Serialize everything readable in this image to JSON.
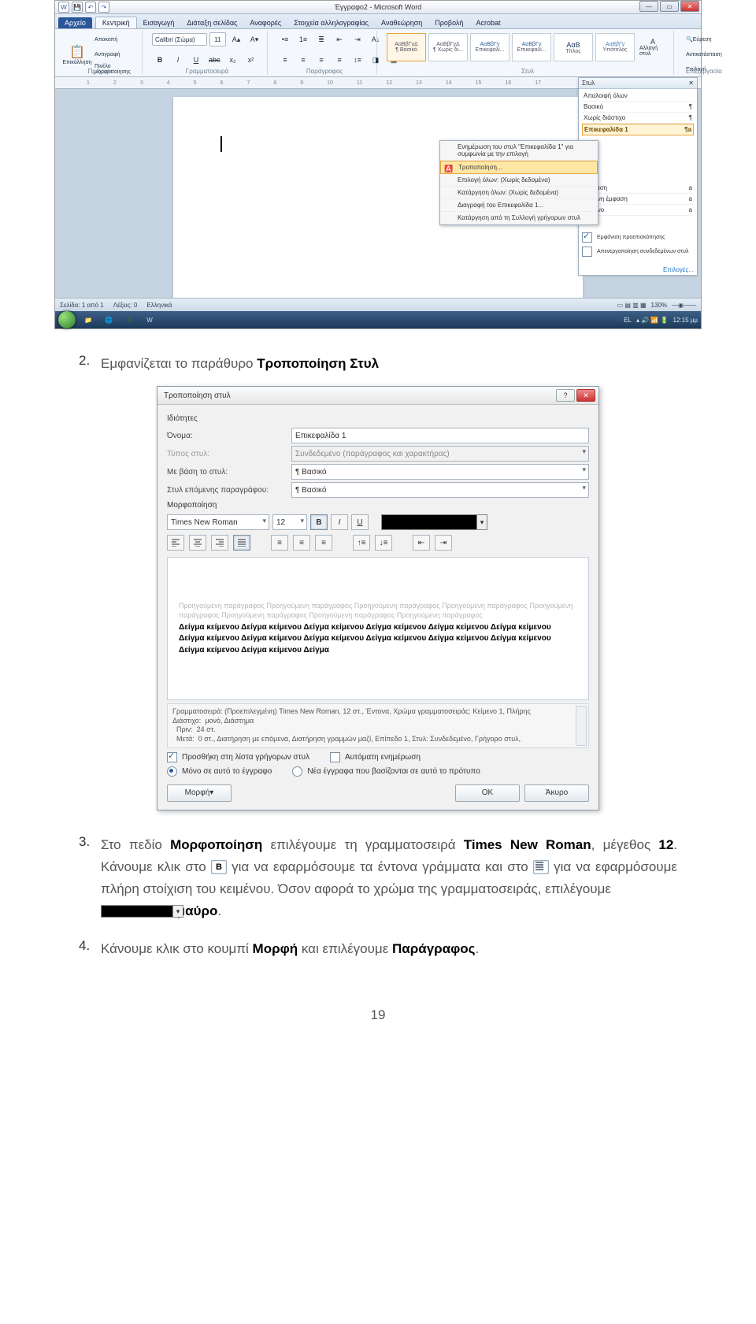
{
  "word": {
    "title": "Έγγραφο2 - Microsoft Word",
    "qat_icons": [
      "word-icon",
      "save-icon",
      "undo-icon",
      "redo-icon"
    ],
    "tabs": {
      "file": "Αρχείο",
      "list": [
        "Κεντρική",
        "Εισαγωγή",
        "Διάταξη σελίδας",
        "Αναφορές",
        "Στοιχεία αλληλογραφίας",
        "Αναθεώρηση",
        "Προβολή",
        "Acrobat"
      ],
      "active": "Κεντρική"
    },
    "ribbon": {
      "clipboard": {
        "paste": "Επικόλληση",
        "cut": "Αποκοπή",
        "copy": "Αντιγραφή",
        "fmtpainter": "Πινέλο μορφοποίησης",
        "label": "Πρόχειρο"
      },
      "font": {
        "face": "Calibri (Σώμα)",
        "size": "11",
        "label": "Γραμματοσειρά"
      },
      "paragraph": {
        "label": "Παράγραφος"
      },
      "styles": {
        "list": [
          "ΑαΒβΓγΔ",
          "ΑαΒβΓγΔ",
          "ΑαΒβΓγ",
          "ΑαΒβΓγ",
          "ΑαΒ",
          "ΑαΒβΓγ"
        ],
        "names": [
          "¶ Βασικό",
          "¶ Χωρίς δι...",
          "Επικεφαλί...",
          "Επικεφαλί...",
          "Τίτλος",
          "Υπότιτλος"
        ],
        "change": "Αλλαγή στυλ",
        "label": "Στυλ"
      },
      "editing": {
        "find": "Εύρεση",
        "replace": "Αντικατάσταση",
        "select": "Επιλογή",
        "label": "Επεξεργασία"
      }
    },
    "ruler_ticks": [
      "1",
      "2",
      "3",
      "4",
      "5",
      "6",
      "7",
      "8",
      "9",
      "10",
      "11",
      "12",
      "13",
      "14",
      "15",
      "16",
      "17"
    ],
    "stylespane": {
      "title": "Στυλ",
      "clear": "Απαλοιφή όλων",
      "items": [
        "Βασικό",
        "Χωρίς διάστιχο",
        "Επικεφαλίδα 1",
        "Έμφαση",
        "Έντονη έμφαση",
        "Έντονο"
      ],
      "selected": "Επικεφαλίδα 1",
      "preview_chk": "Εμφάνιση προεπισκόπησης",
      "disable_chk": "Απενεργοποίηση συνδεδεμένων στυλ",
      "options": "Επιλογές..."
    },
    "contextmenu": {
      "update": "Ενημέρωση του στυλ \"Επικεφαλίδα 1\" για συμφωνία με την επιλογή",
      "modify": "Τροποποίηση...",
      "selectall": "Επιλογή όλων: (Χωρίς δεδομένα)",
      "removeall": "Κατάργηση όλων: (Χωρίς δεδομένα)",
      "delete": "Διαγραφή του Επικεφαλίδα 1...",
      "removeq": "Κατάργηση από τη Συλλογή γρήγορων στυλ"
    },
    "status": {
      "page": "Σελίδα: 1 από 1",
      "words": "Λέξεις: 0",
      "lang": "Ελληνικά",
      "zoom": "130%"
    },
    "taskbar": {
      "lang": "EL",
      "time": "12:15 μμ"
    }
  },
  "dialog": {
    "title": "Τροποποίηση στυλ",
    "sec_props": "Ιδιότητες",
    "name_lbl": "Όνομα:",
    "name_val": "Επικεφαλίδα 1",
    "type_lbl": "Τύπος στυλ:",
    "type_val": "Συνδεδεμένο (παράγραφος και χαρακτήρας)",
    "based_lbl": "Με βάση το στυλ:",
    "based_val": "¶ Βασικό",
    "next_lbl": "Στυλ επόμενης παραγράφου:",
    "next_val": "¶ Βασικό",
    "sec_fmt": "Μορφοποίηση",
    "font_face": "Times New Roman",
    "font_size": "12",
    "preview_grey": "Προηγούμενη παράγραφος Προηγούμενη παράγραφος Προηγούμενη παράγραφος Προηγούμενη παράγραφος Προηγούμενη παράγραφος Προηγούμενη παράγραφος Προηγούμενη παράγραφος Προηγούμενη παράγραφος",
    "preview_black": "Δείγμα κείμενου Δείγμα κείμενου Δείγμα κείμενου Δείγμα κείμενου Δείγμα κείμενου Δείγμα κείμενου Δείγμα κείμενου Δείγμα κείμενου Δείγμα κείμενου Δείγμα κείμενου Δείγμα κείμενου Δείγμα κείμενου Δείγμα κείμενου Δείγμα κείμενου Δείγμα",
    "desc": "Γραμματοσειρά: (Προεπιλεγμένη) Times New Roman, 12 στ., Έντονα, Χρώμα γραμματοσειράς: Κείμενο 1, Πλήρης\nΔιάστιχο:  μονό, Διάστημα\n  Πριν:  24 στ.\n  Μετά:  0 στ., Διατήρηση με επόμενα, Διατήρηση γραμμών μαζί, Επίπεδο 1, Στυλ: Συνδεδεμένο, Γρήγορο στυλ,",
    "add_quick": "Προσθήκη στη λίστα γρήγορων στυλ",
    "auto_update": "Αυτόματη ενημέρωση",
    "only_doc": "Μόνο σε αυτό το έγγραφο",
    "new_docs": "Νέα έγγραφα που βασίζονται σε αυτό το πρότυπο",
    "format_btn": "Μορφή",
    "ok": "OK",
    "cancel": "Άκυρο"
  },
  "text": {
    "step2_n": "2.",
    "step2": "Εμφανίζεται το παράθυρο ",
    "step2_b": "Τροποποίηση Στυλ",
    "step3_n": "3.",
    "step3_a": "Στο πεδίο ",
    "step3_b1": "Μορφοποίηση",
    "step3_c": " επιλέγουμε τη γραμματοσειρά ",
    "step3_b2": "Times New Roman",
    "step3_d": ", μέγεθος ",
    "step3_b3": "12",
    "step3_e": ". Κάνουμε κλικ στο ",
    "step3_f": " για να εφαρμόσουμε τα έντονα γράμματα και στο ",
    "step3_g": " για να εφαρμόσουμε πλήρη στοίχιση του κειμένου. Όσον αφορά το χρώμα της γραμματοσειράς, επιλέγουμε ",
    "step3_h": " ",
    "step3_b4": "μαύρο",
    "step3_i": ".",
    "step4_n": "4.",
    "step4_a": "Κάνουμε κλικ στο κουμπί ",
    "step4_b1": "Μορφή",
    "step4_b": " και επιλέγουμε ",
    "step4_b2": "Παράγραφος",
    "step4_c": ".",
    "pagenum": "19"
  }
}
